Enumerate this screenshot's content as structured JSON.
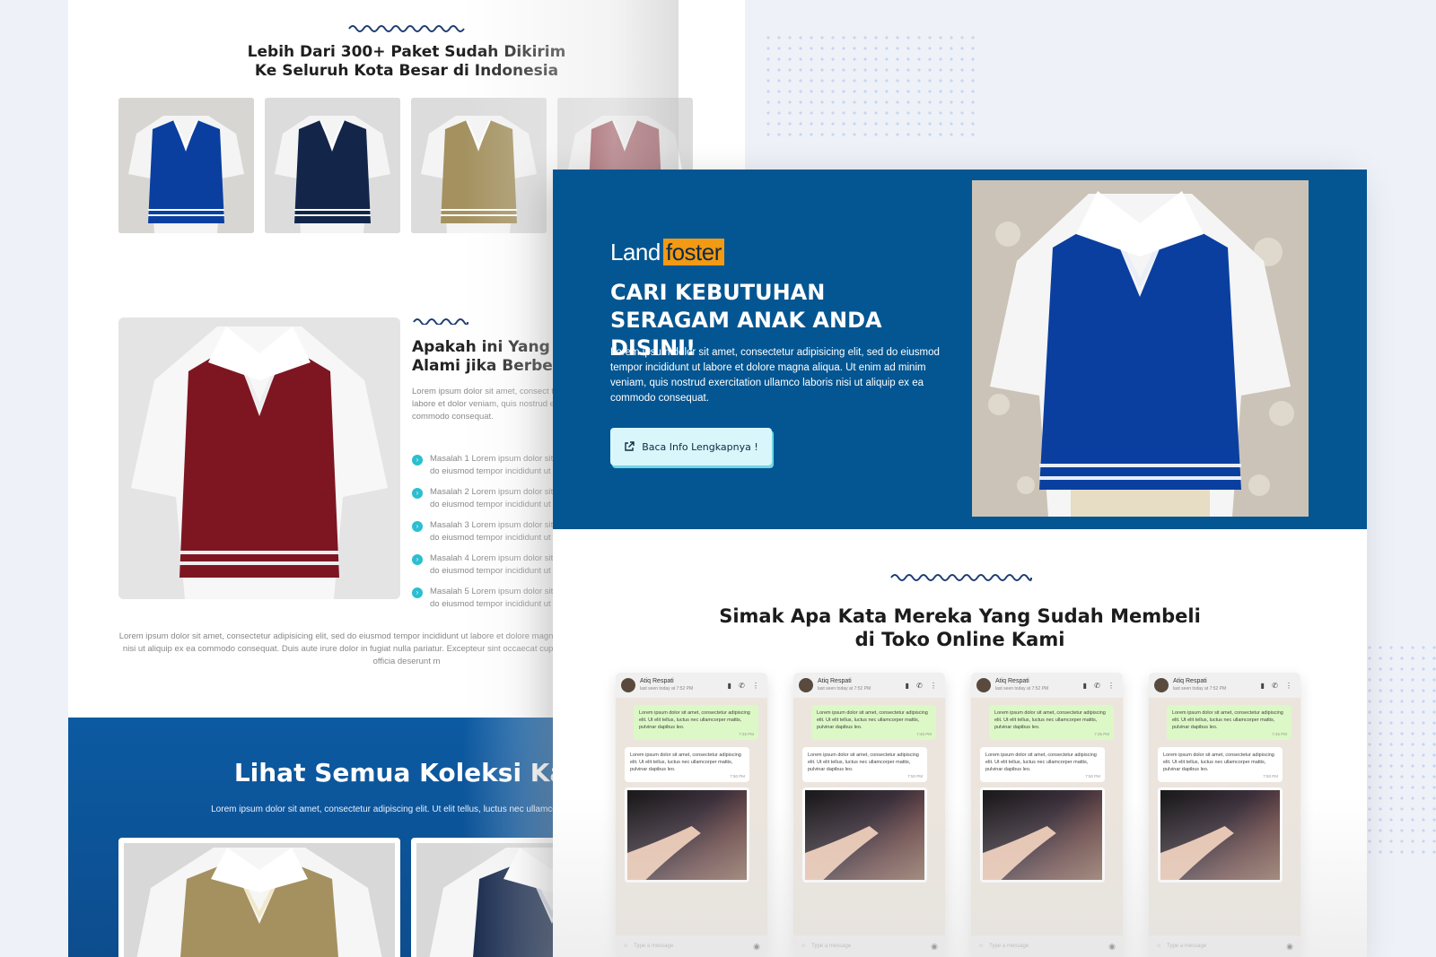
{
  "back_page": {
    "delivery_title_line1": "Lebih Dari 300+ Paket Sudah Dikirim",
    "delivery_title_line2": "Ke Seluruh Kota Besar di Indonesia",
    "problem_title_line1": "Apakah ini Yang S",
    "problem_title_line2": "Alami jika Berbela",
    "problem_body": "Lorem ipsum dolor sit amet, consect tempor incididunt ut labore et dolor veniam, quis nostrud exercitation u commodo consequat.",
    "problems": [
      {
        "line1": "Masalah 1 Lorem ipsum dolor sit",
        "line2": "do eiusmod tempor incididunt ut"
      },
      {
        "line1": "Masalah 2 Lorem ipsum dolor sit",
        "line2": "do eiusmod tempor incididunt ut"
      },
      {
        "line1": "Masalah 3 Lorem ipsum dolor sit",
        "line2": "do eiusmod tempor incididunt ut"
      },
      {
        "line1": "Masalah 4 Lorem ipsum dolor sit",
        "line2": "do eiusmod tempor incididunt ut"
      },
      {
        "line1": "Masalah 5 Lorem ipsum dolor sit",
        "line2": "do eiusmod tempor incididunt ut"
      }
    ],
    "paragraph": "Lorem ipsum dolor sit amet, consectetur adipisicing elit, sed do eiusmod tempor incididunt ut labore et dolore magna nostrud exercitation ullamco laboris nisi ut aliquip ex ea commodo consequat. Duis aute irure dolor in fugiat nulla pariatur. Excepteur sint occaecat cupidatat non proident, sunt in culpa qui officia deserunt m",
    "collection_title": "Lihat Semua Koleksi Kar",
    "collection_sub": "Lorem ipsum dolor sit amet, consectetur adipiscing elit. Ut elit tellus, luctus nec ullamcorper mattis,"
  },
  "front_page": {
    "logo_land": "Land",
    "logo_foster": "foster",
    "hero_title": "Cari Kebutuhan Seragam Anak Anda Disini!",
    "hero_body": "Lorem ipsum dolor sit amet, consectetur adipisicing elit, sed do eiusmod tempor incididunt ut labore et dolore magna aliqua. Ut enim ad minim veniam, quis nostrud exercitation ullamco laboris nisi ut aliquip ex ea commodo consequat.",
    "cta_label": "Baca Info Lengkapnya !",
    "testimonial_title_line1": "Simak Apa Kata Mereka Yang Sudah Membeli",
    "testimonial_title_line2": "di Toko Online Kami",
    "chat": {
      "name": "Atiq Respati",
      "status": "last seen today at 7:52 PM",
      "msg_out": "Lorem ipsum dolor sit amet, consectetur adipiscing elit. Ut elit tellus, luctus nec ullamcorper mattis, pulvinar dapibus leo.",
      "time_out": "7:45 PM",
      "msg_in": "Lorem ipsum dolor sit amet, consectetur adipiscing elit. Ut elit tellus, luctus nec ullamcorper mattis, pulvinar dapibus leo.",
      "time_in": "7:50 PM",
      "time_img": "7:52 PM",
      "input_placeholder": "Type a message"
    }
  },
  "colors": {
    "navy_vest": "#0a3fa0",
    "dark_navy_vest": "#13264a",
    "khaki_vest": "#a4915f",
    "maroon_vest": "#7e1622",
    "hero_blue": "#035692",
    "logo_orange": "#f29a14",
    "check_cyan": "#2bbfd0"
  }
}
